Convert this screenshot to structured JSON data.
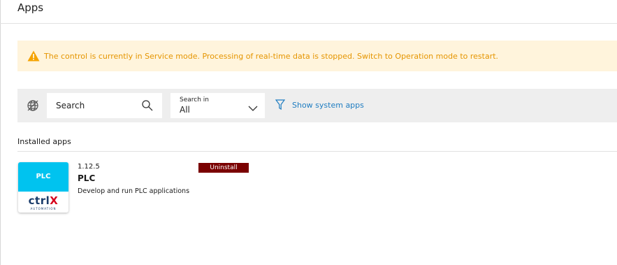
{
  "header": {
    "title": "Apps"
  },
  "alert": {
    "message": "The control is currently in Service mode. Processing of real-time data is stopped. Switch to Operation mode to restart.",
    "color": "#e59500",
    "background": "#fff4dc",
    "icon": "warning-icon"
  },
  "toolbar": {
    "globe_icon": "globe-off-icon",
    "search": {
      "placeholder": "Search",
      "icon": "search-icon"
    },
    "search_in": {
      "label": "Search in",
      "value": "All",
      "icon": "chevron-down-icon"
    },
    "filter": {
      "label": "Show system apps",
      "icon": "filter-icon",
      "color": "#1f7dc1"
    }
  },
  "installed": {
    "title": "Installed apps",
    "apps": [
      {
        "version": "1.12.5",
        "name": "PLC",
        "description": "Develop and run PLC applications",
        "uninstall_label": "Uninstall",
        "logo": {
          "tile_text": "PLC",
          "brand_main": "ctrl",
          "brand_x": "X",
          "brand_sub": "AUTOMATION",
          "tile_color": "#00c3ef"
        }
      }
    ]
  }
}
